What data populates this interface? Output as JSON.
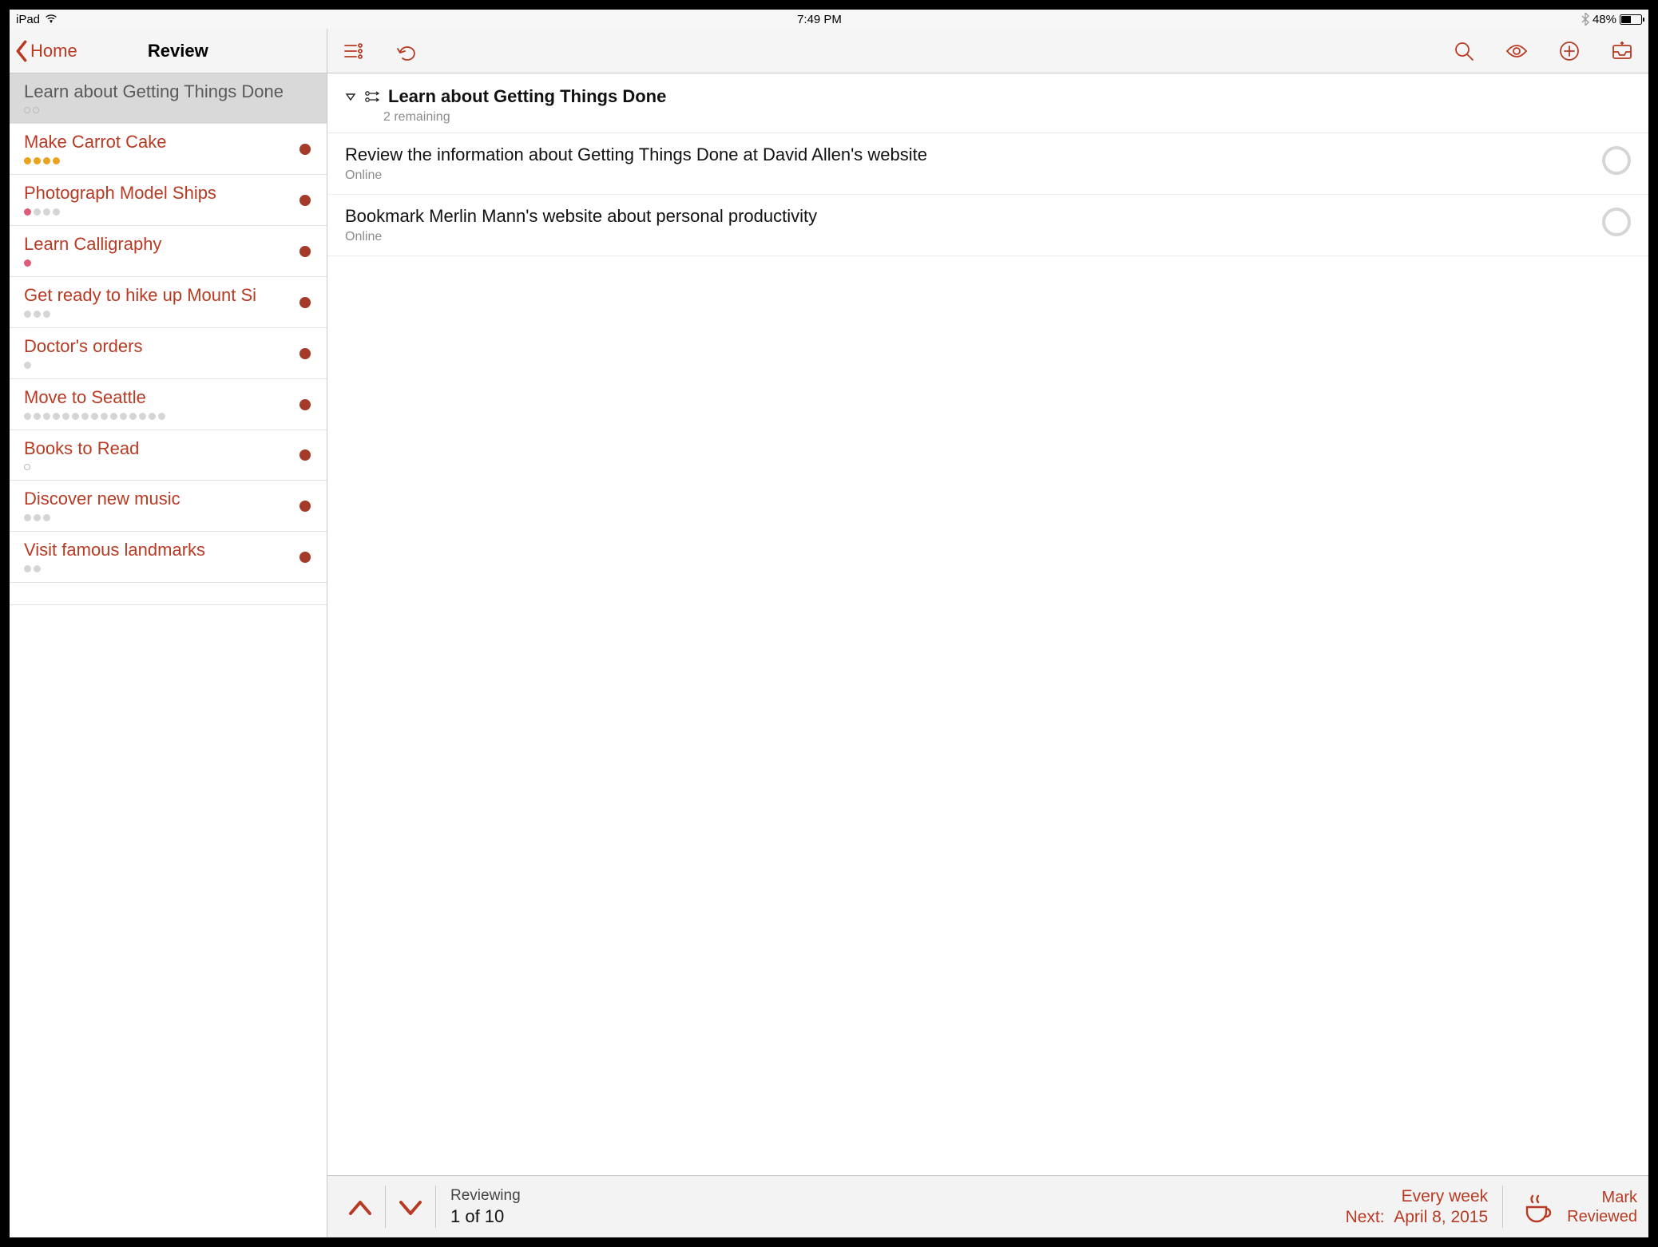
{
  "statusbar": {
    "device": "iPad",
    "time": "7:49 PM",
    "battery_pct": "48%"
  },
  "nav": {
    "back_label": "Home",
    "title": "Review"
  },
  "sidebar": {
    "items": [
      {
        "title": "Learn about Getting Things Done",
        "selected": true,
        "dots": [
          "ring",
          "ring"
        ],
        "status": false
      },
      {
        "title": "Make Carrot Cake",
        "dots": [
          "orange",
          "orange",
          "orange",
          "orange"
        ],
        "status": true
      },
      {
        "title": "Photograph Model Ships",
        "dots": [
          "pink",
          "grey",
          "grey",
          "grey"
        ],
        "status": true
      },
      {
        "title": "Learn Calligraphy",
        "dots": [
          "pink"
        ],
        "status": true
      },
      {
        "title": "Get ready to hike up Mount Si",
        "dots": [
          "grey",
          "grey",
          "grey"
        ],
        "status": true
      },
      {
        "title": "Doctor's orders",
        "dots": [
          "grey"
        ],
        "status": true
      },
      {
        "title": "Move to Seattle",
        "dots": [
          "grey",
          "grey",
          "grey",
          "grey",
          "grey",
          "grey",
          "grey",
          "grey",
          "grey",
          "grey",
          "grey",
          "grey",
          "grey",
          "grey",
          "grey"
        ],
        "status": true
      },
      {
        "title": "Books to Read",
        "dots": [
          "ring"
        ],
        "status": true
      },
      {
        "title": "Discover new music",
        "dots": [
          "grey",
          "grey",
          "grey"
        ],
        "status": true
      },
      {
        "title": "Visit famous landmarks",
        "dots": [
          "grey",
          "grey"
        ],
        "status": true
      }
    ]
  },
  "main": {
    "project_title": "Learn about Getting Things Done",
    "remaining": "2 remaining",
    "tasks": [
      {
        "title": "Review the information about Getting Things Done at David Allen's website",
        "context": "Online"
      },
      {
        "title": "Bookmark Merlin Mann's website about personal productivity",
        "context": "Online"
      }
    ]
  },
  "footer": {
    "reviewing_label": "Reviewing",
    "counter": "1 of 10",
    "freq": "Every  week",
    "next_label": "Next:",
    "next_date": "April 8, 2015",
    "mark1": "Mark",
    "mark2": "Reviewed"
  }
}
